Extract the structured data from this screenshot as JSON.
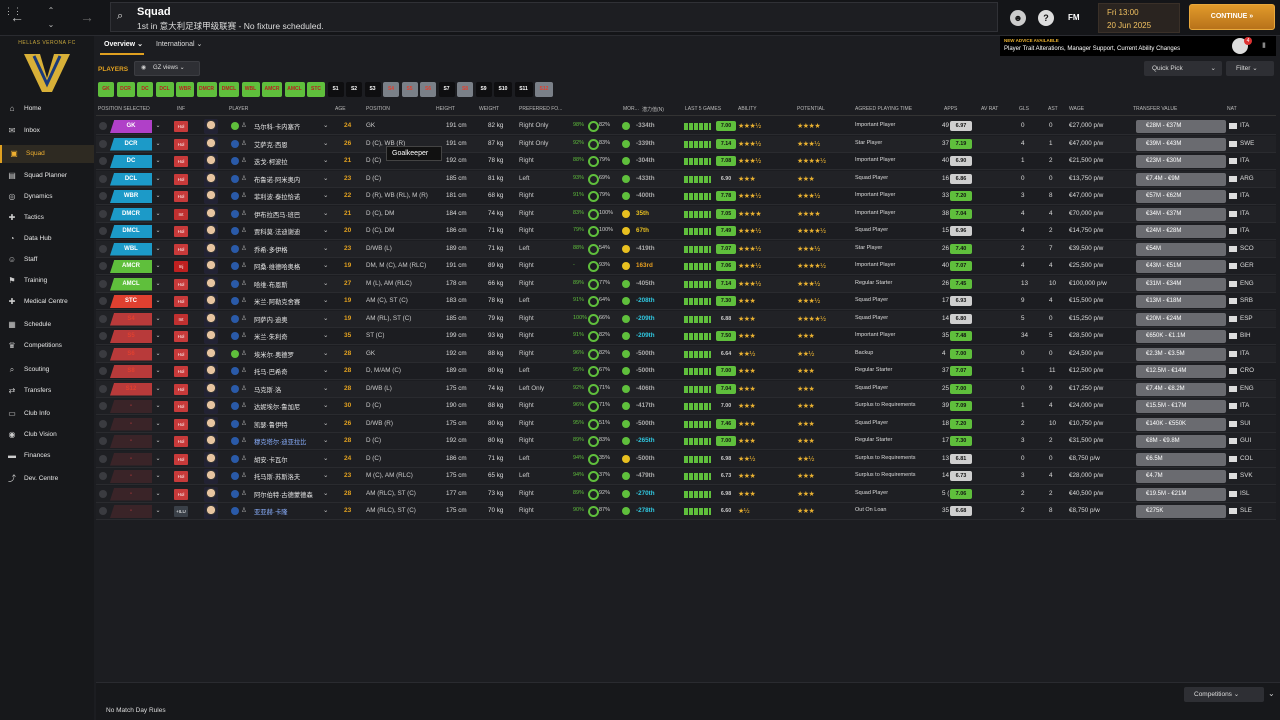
{
  "topbar": {
    "title": "Squad",
    "subtitle": "1st in 意大利足球甲级联赛 - No fixture scheduled.",
    "fm_label": "FM",
    "date_day": "Fri 13:00",
    "date": "20 Jun 2025",
    "continue_label": "CONTINUE"
  },
  "club": {
    "name": "HELLAS VERONA FC"
  },
  "sidebar": {
    "items": [
      {
        "label": "Home",
        "icon": "⌂"
      },
      {
        "label": "Inbox",
        "icon": "✉"
      },
      {
        "label": "Squad",
        "icon": "▣"
      },
      {
        "label": "Squad Planner",
        "icon": "▤"
      },
      {
        "label": "Dynamics",
        "icon": "◎"
      },
      {
        "label": "Tactics",
        "icon": "✚"
      },
      {
        "label": "Data Hub",
        "icon": "◔"
      },
      {
        "label": "Staff",
        "icon": "☺"
      },
      {
        "label": "Training",
        "icon": "⚑"
      },
      {
        "label": "Medical Centre",
        "icon": "✚"
      },
      {
        "label": "Schedule",
        "icon": "▦"
      },
      {
        "label": "Competitions",
        "icon": "♛"
      },
      {
        "label": "Scouting",
        "icon": "⌕"
      },
      {
        "label": "Transfers",
        "icon": "⇄"
      },
      {
        "label": "Club Info",
        "icon": "▭"
      },
      {
        "label": "Club Vision",
        "icon": "◉"
      },
      {
        "label": "Finances",
        "icon": "▬"
      },
      {
        "label": "Dev. Centre",
        "icon": "⤴"
      }
    ]
  },
  "tabs": {
    "overview": "Overview",
    "international": "International"
  },
  "advice": {
    "heading": "NEW ADVICE AVAILABLE",
    "text": "Player Trait Alterations, Manager Support, Current Ability Changes",
    "badge": "4"
  },
  "players_label": "PLAYERS",
  "gz_views": "GZ views",
  "quick_pick": "Quick Pick",
  "filter": "Filter",
  "position_chips": [
    {
      "l": "GK",
      "c": "#5fbf3c"
    },
    {
      "l": "DCR",
      "c": "#5fbf3c"
    },
    {
      "l": "DC",
      "c": "#5fbf3c"
    },
    {
      "l": "DCL",
      "c": "#5fbf3c"
    },
    {
      "l": "WBR",
      "c": "#5fbf3c"
    },
    {
      "l": "DMCR",
      "c": "#5fbf3c"
    },
    {
      "l": "DMCL",
      "c": "#5fbf3c"
    },
    {
      "l": "WBL",
      "c": "#5fbf3c"
    },
    {
      "l": "AMCR",
      "c": "#5fbf3c"
    },
    {
      "l": "AMCL",
      "c": "#5fbf3c"
    },
    {
      "l": "STC",
      "c": "#5fbf3c"
    },
    {
      "l": "S1",
      "c": "#0e0e10"
    },
    {
      "l": "S2",
      "c": "#0e0e10"
    },
    {
      "l": "S3",
      "c": "#0e0e10"
    },
    {
      "l": "S4",
      "c": "#7a8088"
    },
    {
      "l": "S5",
      "c": "#7a8088"
    },
    {
      "l": "S6",
      "c": "#7a8088"
    },
    {
      "l": "S7",
      "c": "#0e0e10"
    },
    {
      "l": "S8",
      "c": "#7a8088"
    },
    {
      "l": "S9",
      "c": "#0e0e10"
    },
    {
      "l": "S10",
      "c": "#0e0e10"
    },
    {
      "l": "S11",
      "c": "#0e0e10"
    },
    {
      "l": "S12",
      "c": "#7a8088"
    }
  ],
  "headers": {
    "pos": "POSITION SELECTED",
    "inf": "INF",
    "player": "PLAYER",
    "age": "AGE",
    "position": "POSITION",
    "height": "HEIGHT",
    "weight": "WEIGHT",
    "foot": "PREFERRED FO...",
    "mor": "MOR...",
    "rank": "潜力值(N)",
    "last5": "LAST 5 GAMES",
    "ability": "ABILITY",
    "potential": "POTENTIAL",
    "apt": "AGREED PLAYING TIME",
    "apps": "APPS",
    "avrat": "AV RAT",
    "gls": "GLS",
    "ast": "AST",
    "wage": "WAGE",
    "tv": "TRANSFER VALUE",
    "nat": "NAT"
  },
  "players": [
    {
      "sel": "GK",
      "sc": "#b040c8",
      "inf": "Hol",
      "name": "马尔科·卡内塞齐",
      "age": "24",
      "pos": "GK",
      "h": "191 cm",
      "w": "82 kg",
      "foot": "Right Only",
      "fit": "98%",
      "cond": "82%",
      "rank": "-334th",
      "rc": "#aaa",
      "form": "7.00",
      "ab": "★★★½",
      "pot": "★★★★",
      "apt": "Important Player",
      "apps": "49",
      "av": "6.97",
      "ac": "#cfcfcf",
      "g": "0",
      "a": "0",
      "wage": "€27,000 p/w",
      "tv": "€28M - €37M",
      "nat": "ITA"
    },
    {
      "sel": "DCR",
      "sc": "#1c9ac8",
      "inf": "Hol",
      "name": "艾萨克·西恩",
      "age": "26",
      "pos": "D (C), WB (R)",
      "h": "191 cm",
      "w": "87 kg",
      "foot": "Right Only",
      "fit": "92%",
      "cond": "83%",
      "rank": "-339th",
      "rc": "#aaa",
      "form": "7.14",
      "ab": "★★★½",
      "pot": "★★★½",
      "apt": "Star Player",
      "apps": "37 (5)",
      "av": "7.19",
      "ac": "#5fbf3c",
      "g": "4",
      "a": "1",
      "wage": "€47,000 p/w",
      "tv": "€39M - €43M",
      "nat": "SWE"
    },
    {
      "sel": "DC",
      "sc": "#1c9ac8",
      "inf": "Hol",
      "name": "迭戈·柯波拉",
      "age": "21",
      "pos": "D (C)",
      "h": "192 cm",
      "w": "78 kg",
      "foot": "Right",
      "fit": "88%",
      "cond": "79%",
      "rank": "-304th",
      "rc": "#aaa",
      "form": "7.08",
      "ab": "★★★½",
      "pot": "★★★★½",
      "apt": "Important Player",
      "apps": "40 (3)",
      "av": "6.90",
      "ac": "#cfcfcf",
      "g": "1",
      "a": "2",
      "wage": "€21,500 p/w",
      "tv": "€23M - €30M",
      "nat": "ITA"
    },
    {
      "sel": "DCL",
      "sc": "#1c9ac8",
      "inf": "Hol",
      "name": "布鲁诺·阿米奥内",
      "age": "23",
      "pos": "D (C)",
      "h": "185 cm",
      "w": "81 kg",
      "foot": "Left",
      "fit": "93%",
      "cond": "69%",
      "rank": "-433th",
      "rc": "#aaa",
      "form": "6.90",
      "fd": true,
      "ab": "★★★",
      "pot": "★★★",
      "apt": "Squad Player",
      "apps": "16 (7)",
      "av": "6.86",
      "ac": "#cfcfcf",
      "g": "0",
      "a": "0",
      "wage": "€13,750 p/w",
      "tv": "€7.4M - €9M",
      "nat": "ARG"
    },
    {
      "sel": "WBR",
      "sc": "#1c9ac8",
      "inf": "Hol",
      "name": "菲利波·泰拉恰诺",
      "age": "22",
      "pos": "D (R), WB (RL), M (R)",
      "h": "181 cm",
      "w": "68 kg",
      "foot": "Right",
      "fit": "91%",
      "cond": "79%",
      "rank": "-400th",
      "rc": "#aaa",
      "form": "7.78",
      "ab": "★★★½",
      "pot": "★★★½",
      "apt": "Important Player",
      "apps": "33 (10)",
      "av": "7.20",
      "ac": "#5fbf3c",
      "g": "3",
      "a": "8",
      "wage": "€47,000 p/w",
      "tv": "€57M - €62M",
      "nat": "ITA"
    },
    {
      "sel": "DMCR",
      "sc": "#1c9ac8",
      "inf": "Int",
      "name": "伊布拉西马·班巴",
      "age": "21",
      "pos": "D (C), DM",
      "h": "184 cm",
      "w": "74 kg",
      "foot": "Right",
      "fit": "83%",
      "cond": "100%",
      "rank": "35th",
      "rc": "#e8c020",
      "form": "7.05",
      "ab": "★★★★",
      "pot": "★★★★",
      "apt": "Important Player",
      "apps": "38 (3)",
      "av": "7.04",
      "ac": "#5fbf3c",
      "g": "4",
      "a": "4",
      "wage": "€70,000 p/w",
      "tv": "€34M - €37M",
      "nat": "ITA"
    },
    {
      "sel": "DMCL",
      "sc": "#1c9ac8",
      "inf": "Hol",
      "name": "贾科莫·法迪谢迪",
      "age": "20",
      "pos": "D (C), DM",
      "h": "186 cm",
      "w": "71 kg",
      "foot": "Right",
      "fit": "79%",
      "cond": "100%",
      "rank": "67th",
      "rc": "#e8c020",
      "form": "7.49",
      "ab": "★★★½",
      "pot": "★★★★½",
      "apt": "Squad Player",
      "apps": "15 (17)",
      "av": "6.96",
      "ac": "#cfcfcf",
      "g": "4",
      "a": "2",
      "wage": "€14,750 p/w",
      "tv": "€24M - €28M",
      "nat": "ITA"
    },
    {
      "sel": "WBL",
      "sc": "#1c9ac8",
      "inf": "Hol",
      "name": "乔希·多伊格",
      "age": "23",
      "pos": "D/WB (L)",
      "h": "189 cm",
      "w": "71 kg",
      "foot": "Left",
      "fit": "88%",
      "cond": "54%",
      "rank": "-419th",
      "rc": "#aaa",
      "form": "7.07",
      "ab": "★★★½",
      "pot": "★★★½",
      "apt": "Star Player",
      "apps": "26 (6)",
      "av": "7.40",
      "ac": "#5fbf3c",
      "g": "2",
      "a": "7",
      "wage": "€39,500 p/w",
      "tv": "€54M",
      "nat": "SCO"
    },
    {
      "sel": "AMCR",
      "sc": "#5fbf3c",
      "inf": "Inj",
      "name": "阿桑·维德哈奥格",
      "age": "19",
      "pos": "DM, M (C), AM (RLC)",
      "h": "191 cm",
      "w": "89 kg",
      "foot": "Right",
      "fit": "-",
      "cond": "93%",
      "rank": "163rd",
      "rc": "#e8a020",
      "form": "7.06",
      "ab": "★★★½",
      "pot": "★★★★½",
      "apt": "Important Player",
      "apps": "40 (9)",
      "av": "7.07",
      "ac": "#5fbf3c",
      "g": "4",
      "a": "4",
      "wage": "€25,500 p/w",
      "tv": "€43M - €51M",
      "nat": "GER"
    },
    {
      "sel": "AMCL",
      "sc": "#5fbf3c",
      "inf": "Hol",
      "name": "哈维·布恩斯",
      "age": "27",
      "pos": "M (L), AM (RLC)",
      "h": "178 cm",
      "w": "66 kg",
      "foot": "Right",
      "fit": "89%",
      "cond": "77%",
      "rank": "-405th",
      "rc": "#aaa",
      "form": "7.14",
      "ab": "★★★½",
      "pot": "★★★½",
      "apt": "Regular Starter",
      "apps": "26 (2)",
      "av": "7.45",
      "ac": "#5fbf3c",
      "g": "13",
      "a": "10",
      "wage": "€100,000 p/w",
      "tv": "€31M - €34M",
      "nat": "ENG"
    },
    {
      "sel": "STC",
      "sc": "#e04030",
      "inf": "Hol",
      "name": "米兰·阿勒克舍赛",
      "age": "19",
      "pos": "AM (C), ST (C)",
      "h": "183 cm",
      "w": "78 kg",
      "foot": "Left",
      "fit": "91%",
      "cond": "64%",
      "rank": "-208th",
      "rc": "#30c8e0",
      "form": "7.30",
      "ab": "★★★",
      "pot": "★★★½",
      "apt": "Squad Player",
      "apps": "17 (24)",
      "av": "6.93",
      "ac": "#cfcfcf",
      "g": "9",
      "a": "4",
      "wage": "€15,500 p/w",
      "tv": "€13M - €18M",
      "nat": "SRB"
    },
    {
      "sel": "S4",
      "sc": "#b83a3a",
      "inf": "Int",
      "name": "阿萨内·迪奥",
      "age": "19",
      "pos": "AM (RL), ST (C)",
      "h": "185 cm",
      "w": "79 kg",
      "foot": "Right",
      "fit": "100%",
      "cond": "66%",
      "rank": "-209th",
      "rc": "#30c8e0",
      "form": "6.88",
      "fd": true,
      "ab": "★★★",
      "pot": "★★★★½",
      "apt": "Squad Player",
      "apps": "14 (20)",
      "av": "6.80",
      "ac": "#cfcfcf",
      "g": "5",
      "a": "0",
      "wage": "€15,250 p/w",
      "tv": "€20M - €24M",
      "nat": "ESP"
    },
    {
      "sel": "S5",
      "sc": "#b83a3a",
      "inf": "Hol",
      "name": "米兰·朱利奇",
      "age": "35",
      "pos": "ST (C)",
      "h": "199 cm",
      "w": "93 kg",
      "foot": "Right",
      "fit": "91%",
      "cond": "82%",
      "rank": "-209th",
      "rc": "#30c8e0",
      "form": "7.50",
      "ab": "★★★",
      "pot": "★★★",
      "apt": "Important Player",
      "apps": "35 (2)",
      "av": "7.48",
      "ac": "#5fbf3c",
      "g": "34",
      "a": "5",
      "wage": "€28,500 p/w",
      "tv": "€650K - €1.1M",
      "nat": "BIH"
    },
    {
      "sel": "S6",
      "sc": "#b83a3a",
      "inf": "Hol",
      "name": "埃米尔·奥德罗",
      "age": "28",
      "pos": "GK",
      "h": "192 cm",
      "w": "88 kg",
      "foot": "Right",
      "fit": "96%",
      "cond": "82%",
      "rank": "-500th",
      "rc": "#aaa",
      "form": "6.64",
      "fd": true,
      "ab": "★★½",
      "pot": "★★½",
      "apt": "Backup",
      "apps": "4",
      "av": "7.00",
      "ac": "#5fbf3c",
      "g": "0",
      "a": "0",
      "wage": "€24,500 p/w",
      "tv": "€2.3M - €3.5M",
      "nat": "ITA"
    },
    {
      "sel": "S8",
      "sc": "#b83a3a",
      "inf": "Hol",
      "name": "托马·巴希奇",
      "age": "28",
      "pos": "D, M/AM (C)",
      "h": "189 cm",
      "w": "80 kg",
      "foot": "Left",
      "fit": "95%",
      "cond": "67%",
      "rank": "-500th",
      "rc": "#aaa",
      "form": "7.00",
      "ab": "★★★",
      "pot": "★★★",
      "apt": "Regular Starter",
      "apps": "37 (4)",
      "av": "7.07",
      "ac": "#5fbf3c",
      "g": "1",
      "a": "11",
      "wage": "€12,500 p/w",
      "tv": "€12.5M - €14M",
      "nat": "CRO"
    },
    {
      "sel": "S12",
      "sc": "#b83a3a",
      "inf": "Hol",
      "name": "马克斯·洛",
      "age": "28",
      "pos": "D/WB (L)",
      "h": "175 cm",
      "w": "74 kg",
      "foot": "Left Only",
      "fit": "92%",
      "cond": "71%",
      "rank": "-406th",
      "rc": "#aaa",
      "form": "7.04",
      "ab": "★★★",
      "pot": "★★★",
      "apt": "Squad Player",
      "apps": "25 (16)",
      "av": "7.00",
      "ac": "#5fbf3c",
      "g": "0",
      "a": "9",
      "wage": "€17,250 p/w",
      "tv": "€7.4M - €8.2M",
      "nat": "ENG"
    },
    {
      "sel": "-",
      "sc": "#3a2428",
      "inf": "Hol",
      "name": "达妮埃尔·鲁加尼",
      "age": "30",
      "pos": "D (C)",
      "h": "190 cm",
      "w": "88 kg",
      "foot": "Right",
      "fit": "96%",
      "cond": "71%",
      "rank": "-417th",
      "rc": "#aaa",
      "form": "7.00",
      "fd": true,
      "ab": "★★★",
      "pot": "★★★",
      "apt": "Surplus to Requirements",
      "apps": "39",
      "av": "7.09",
      "ac": "#5fbf3c",
      "g": "1",
      "a": "4",
      "wage": "€24,000 p/w",
      "tv": "€15.5M - €17M",
      "nat": "ITA"
    },
    {
      "sel": "-",
      "sc": "#3a2428",
      "inf": "Hol",
      "name": "凯瑟·鲁伊特",
      "age": "26",
      "pos": "D/WB (R)",
      "h": "175 cm",
      "w": "80 kg",
      "foot": "Right",
      "fit": "95%",
      "cond": "51%",
      "rank": "-500th",
      "rc": "#aaa",
      "form": "7.46",
      "ab": "★★★",
      "pot": "★★★",
      "apt": "Squad Player",
      "apps": "18 (18)",
      "av": "7.20",
      "ac": "#5fbf3c",
      "g": "2",
      "a": "10",
      "wage": "€10,750 p/w",
      "tv": "€140K - €550K",
      "nat": "SUI"
    },
    {
      "sel": "-",
      "sc": "#3a2428",
      "inf": "Hol",
      "name": "穆克塔尔·迪亚拉比",
      "age": "28",
      "pos": "D (C)",
      "h": "192 cm",
      "w": "80 kg",
      "foot": "Right",
      "fit": "89%",
      "cond": "83%",
      "rank": "-265th",
      "rc": "#30c8e0",
      "form": "7.00",
      "ab": "★★★",
      "pot": "★★★",
      "apt": "Regular Starter",
      "apps": "17 (6)",
      "av": "7.30",
      "ac": "#5fbf3c",
      "g": "3",
      "a": "2",
      "wage": "€31,500 p/w",
      "tv": "€8M - €9.8M",
      "nat": "GUI",
      "nc": "#8ab0ff"
    },
    {
      "sel": "-",
      "sc": "#3a2428",
      "inf": "Hol",
      "name": "胡安·卡瓦尔",
      "age": "24",
      "pos": "D (C)",
      "h": "186 cm",
      "w": "71 kg",
      "foot": "Left",
      "fit": "94%",
      "cond": "35%",
      "rank": "-500th",
      "rc": "#aaa",
      "form": "6.98",
      "fd": true,
      "ab": "★★½",
      "pot": "★★½",
      "apt": "Surplus to Requirements",
      "apps": "13 (5)",
      "av": "6.81",
      "ac": "#cfcfcf",
      "g": "0",
      "a": "0",
      "wage": "€8,750 p/w",
      "tv": "€6.5M",
      "nat": "COL"
    },
    {
      "sel": "-",
      "sc": "#3a2428",
      "inf": "Hol",
      "name": "托马斯·苏斯洛夫",
      "age": "23",
      "pos": "M (C), AM (RLC)",
      "h": "175 cm",
      "w": "65 kg",
      "foot": "Left",
      "fit": "94%",
      "cond": "37%",
      "rank": "-479th",
      "rc": "#aaa",
      "form": "6.73",
      "fd": true,
      "ab": "★★★",
      "pot": "★★★",
      "apt": "Surplus to Requirements",
      "apps": "14 (19)",
      "av": "6.73",
      "ac": "#cfcfcf",
      "g": "3",
      "a": "4",
      "wage": "€28,000 p/w",
      "tv": "€4.7M",
      "nat": "SVK"
    },
    {
      "sel": "-",
      "sc": "#3a2428",
      "inf": "Hol",
      "name": "阿尔伯特·古德蒙德森",
      "age": "28",
      "pos": "AM (RLC), ST (C)",
      "h": "177 cm",
      "w": "73 kg",
      "foot": "Right",
      "fit": "89%",
      "cond": "92%",
      "rank": "-270th",
      "rc": "#30c8e0",
      "form": "6.98",
      "fd": true,
      "ab": "★★★",
      "pot": "★★★",
      "apt": "Squad Player",
      "apps": "5 (16)",
      "av": "7.06",
      "ac": "#5fbf3c",
      "g": "2",
      "a": "2",
      "wage": "€40,500 p/w",
      "tv": "€19.5M - €21M",
      "nat": "ISL"
    },
    {
      "sel": "-",
      "sc": "#3a2428",
      "inf": "+ILU",
      "name": "亚亚赫·卡隆",
      "age": "23",
      "pos": "AM (RLC), ST (C)",
      "h": "175 cm",
      "w": "70 kg",
      "foot": "Right",
      "fit": "90%",
      "cond": "87%",
      "rank": "-278th",
      "rc": "#30c8e0",
      "form": "6.60",
      "fd": true,
      "ab": "★½",
      "pot": "★★★",
      "apt": "Out On Loan",
      "apps": "35 (1)",
      "av": "6.68",
      "ac": "#cfcfcf",
      "g": "2",
      "a": "8",
      "wage": "€8,750 p/w",
      "tv": "€275K",
      "nat": "SLE",
      "nc": "#8ab0ff"
    }
  ],
  "tooltip": "Goalkeeper",
  "footer": {
    "match_day": "No Match Day Rules",
    "competitions": "Competitions"
  }
}
